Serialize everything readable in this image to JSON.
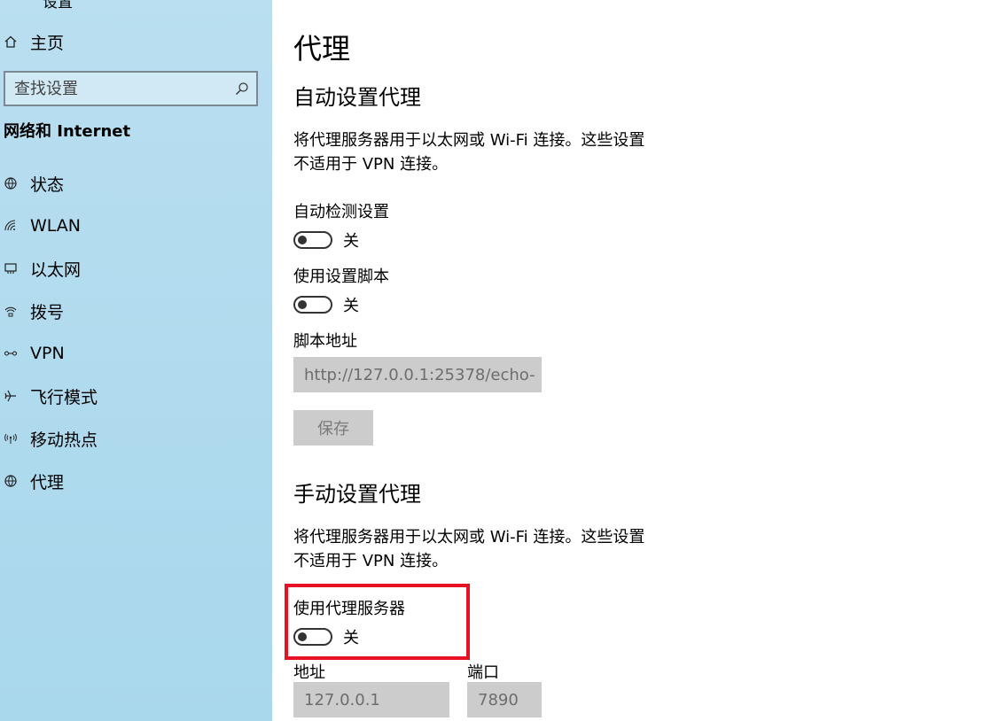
{
  "sidebar": {
    "app_title": "设置",
    "home_label": "主页",
    "search_placeholder": "查找设置",
    "section_title": "网络和 Internet",
    "items": [
      {
        "label": "状态",
        "icon": "globe-status-icon"
      },
      {
        "label": "WLAN",
        "icon": "wifi-icon"
      },
      {
        "label": "以太网",
        "icon": "ethernet-icon"
      },
      {
        "label": "拨号",
        "icon": "dialup-icon"
      },
      {
        "label": "VPN",
        "icon": "vpn-icon"
      },
      {
        "label": "飞行模式",
        "icon": "airplane-icon"
      },
      {
        "label": "移动热点",
        "icon": "hotspot-icon"
      },
      {
        "label": "代理",
        "icon": "globe-icon"
      }
    ]
  },
  "main": {
    "page_title": "代理",
    "auto": {
      "heading": "自动设置代理",
      "description_line1": "将代理服务器用于以太网或 Wi-Fi 连接。这些设置",
      "description_line2": "不适用于 VPN 连接。",
      "detect_label": "自动检测设置",
      "detect_state": "关",
      "script_label": "使用设置脚本",
      "script_state": "关",
      "script_address_label": "脚本地址",
      "script_address_value": "http://127.0.0.1:25378/echo-",
      "save_label": "保存"
    },
    "manual": {
      "heading": "手动设置代理",
      "description_line1": "将代理服务器用于以太网或 Wi-Fi 连接。这些设置",
      "description_line2": "不适用于 VPN 连接。",
      "use_proxy_label": "使用代理服务器",
      "use_proxy_state": "关",
      "address_label": "地址",
      "address_value": "127.0.0.1",
      "port_label": "端口",
      "port_value": "7890"
    }
  },
  "colors": {
    "sidebar_bg": "#afdaee",
    "highlight": "#e81123",
    "disabled_input": "#cccccc"
  }
}
